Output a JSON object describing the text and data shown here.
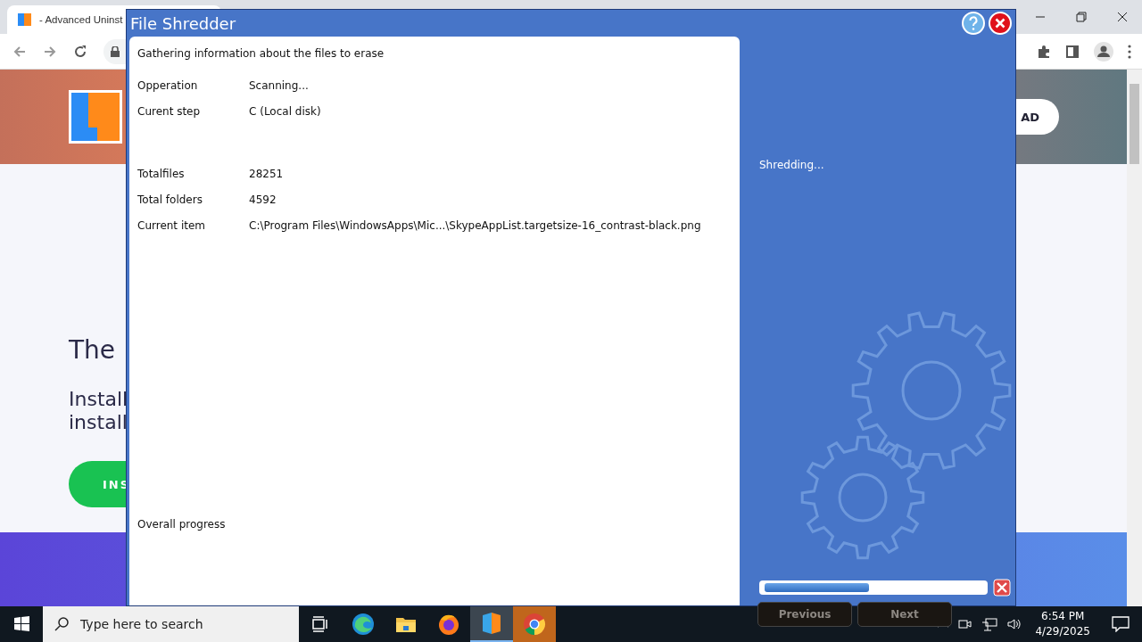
{
  "browser": {
    "tab_title": "- Advanced Uninst",
    "page": {
      "heading": "The",
      "text_lines": [
        "Install",
        "install"
      ],
      "install_button": "INS",
      "download_button": "AD"
    }
  },
  "dialog": {
    "title": "File Shredder",
    "status": "Gathering information about the files to erase",
    "groups": [
      [
        {
          "label": "Opperation",
          "value": "Scanning..."
        },
        {
          "label": "Curent step",
          "value": "C (Local disk)"
        }
      ],
      [
        {
          "label": "Totalfiles",
          "value": "28251"
        },
        {
          "label": "Total folders",
          "value": "4592"
        },
        {
          "label": "Current item",
          "value": "C:\\Program Files\\WindowsApps\\Mic...\\SkypeAppList.targetsize-16_contrast-black.png"
        }
      ]
    ],
    "overall_label": "Overall progress",
    "side_status": "Shredding...",
    "progress": {
      "level": 0.48
    },
    "buttons": [
      {
        "label": "Previous",
        "disabled": true
      },
      {
        "label": "Next",
        "disabled": true
      }
    ]
  },
  "taskbar": {
    "search_placeholder": "Type here to search",
    "apps": [
      {
        "kind": "taskview",
        "active": false,
        "attention": false
      },
      {
        "kind": "edge",
        "active": false,
        "attention": false
      },
      {
        "kind": "folder",
        "active": false,
        "attention": false
      },
      {
        "kind": "firefox",
        "active": false,
        "attention": false
      },
      {
        "kind": "uninstaller",
        "active": true,
        "attention": false
      },
      {
        "kind": "chrome",
        "active": false,
        "attention": true
      }
    ],
    "time": "6:54 PM",
    "date": "4/29/2025"
  }
}
